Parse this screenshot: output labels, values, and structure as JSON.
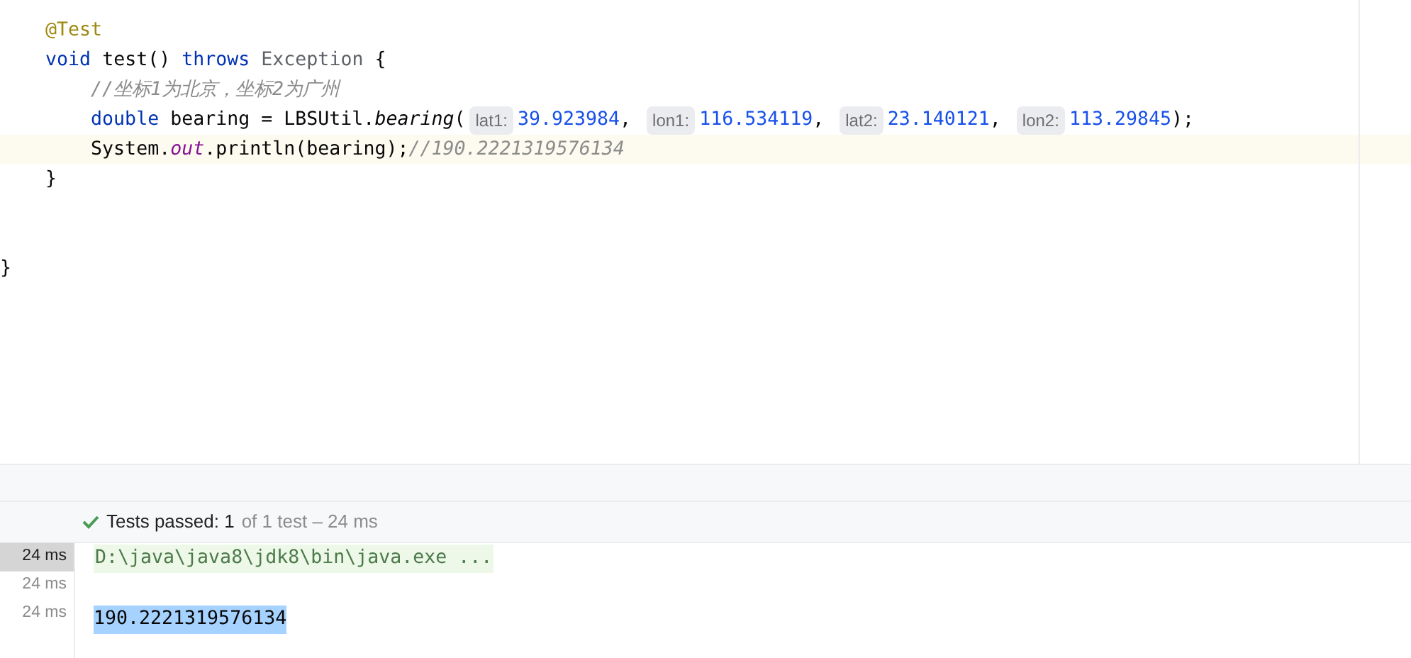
{
  "editor": {
    "lines": [
      {
        "current": false,
        "tokens": [
          {
            "kind": "annotation",
            "text": "    @Test"
          }
        ]
      },
      {
        "current": false,
        "tokens": [
          {
            "kind": "keyword",
            "text": "    void "
          },
          {
            "kind": "plain",
            "text": "test() "
          },
          {
            "kind": "keyword",
            "text": "throws "
          },
          {
            "kind": "type",
            "text": "Exception "
          },
          {
            "kind": "plain",
            "text": "{"
          }
        ]
      },
      {
        "current": false,
        "tokens": [
          {
            "kind": "comment",
            "text": "        //坐标1为北京，坐标2为广州"
          }
        ]
      },
      {
        "current": false,
        "tokens": [
          {
            "kind": "keyword",
            "text": "        double "
          },
          {
            "kind": "plain",
            "text": "bearing = LBSUtil."
          },
          {
            "kind": "method",
            "text": "bearing"
          },
          {
            "kind": "plain",
            "text": "("
          },
          {
            "kind": "hint",
            "text": "lat1:"
          },
          {
            "kind": "number",
            "text": "39.923984"
          },
          {
            "kind": "plain",
            "text": ", "
          },
          {
            "kind": "hint",
            "text": "lon1:"
          },
          {
            "kind": "number",
            "text": "116.534119"
          },
          {
            "kind": "plain",
            "text": ", "
          },
          {
            "kind": "hint",
            "text": "lat2:"
          },
          {
            "kind": "number",
            "text": "23.140121"
          },
          {
            "kind": "plain",
            "text": ", "
          },
          {
            "kind": "hint",
            "text": "lon2:"
          },
          {
            "kind": "number",
            "text": "113.29845"
          },
          {
            "kind": "plain",
            "text": ");"
          }
        ]
      },
      {
        "current": true,
        "tokens": [
          {
            "kind": "plain",
            "text": "        System."
          },
          {
            "kind": "field",
            "text": "out"
          },
          {
            "kind": "plain",
            "text": ".println(bearing);"
          },
          {
            "kind": "comment",
            "text": "//190.2221319576134"
          }
        ]
      },
      {
        "current": false,
        "tokens": [
          {
            "kind": "plain",
            "text": "    }"
          }
        ]
      },
      {
        "current": false
      },
      {
        "current": false
      },
      {
        "current": false,
        "tokens": [
          {
            "kind": "plain",
            "text": "}"
          }
        ]
      }
    ]
  },
  "status": {
    "passed": true,
    "label": "Tests passed: 1",
    "detail": "of 1 test – 24 ms"
  },
  "timings": [
    {
      "text": "24 ms",
      "selected": true
    },
    {
      "text": "24 ms",
      "selected": false
    },
    {
      "text": "24 ms",
      "selected": false
    }
  ],
  "console": [
    {
      "kind": "command",
      "text": "D:\\java\\java8\\jdk8\\bin\\java.exe ..."
    },
    {
      "kind": "blank"
    },
    {
      "kind": "selected",
      "text": "190.2221319576134"
    }
  ]
}
